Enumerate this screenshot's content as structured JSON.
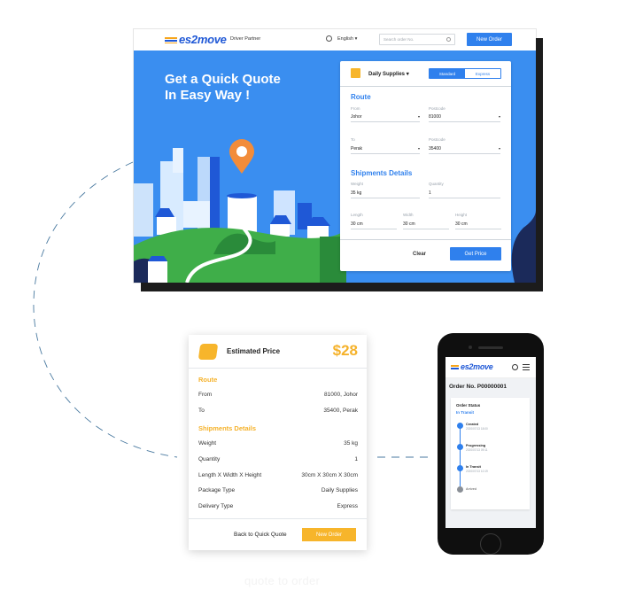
{
  "desktop": {
    "logo": {
      "prefix": "es",
      "two": "2",
      "suffix": "move"
    },
    "nav_driver": "Driver Partner",
    "language": "English",
    "search_placeholder": "Search order No.",
    "new_order": "New Order",
    "hero_title_1": "Get a Quick Quote",
    "hero_title_2": "In Easy Way !",
    "quote_card": {
      "package_type": "Daily Supplies",
      "delivery_options": [
        "Standard",
        "Express"
      ],
      "selected_delivery": "Standard",
      "route_title": "Route",
      "from_label": "From",
      "from_value": "Johor",
      "from_postcode_label": "Postcode",
      "from_postcode_value": "81000",
      "to_label": "To",
      "to_value": "Perak",
      "to_postcode_label": "Postcode",
      "to_postcode_value": "35400",
      "shipments_title": "Shipments Details",
      "weight_label": "Weight",
      "weight_value": "35 kg",
      "quantity_label": "Quantity",
      "quantity_value": "1",
      "length_label": "Length",
      "length_value": "30 cm",
      "width_label": "Width",
      "width_value": "30 cm",
      "height_label": "Height",
      "height_value": "30 cm",
      "clear": "Clear",
      "get_price": "Get Price"
    }
  },
  "price_card": {
    "title": "Estimated Price",
    "amount": "$28",
    "route_title": "Route",
    "from_label": "From",
    "from_value": "81000, Johor",
    "to_label": "To",
    "to_value": "35400, Perak",
    "shipments_title": "Shipments Details",
    "weight_label": "Weight",
    "weight_value": "35 kg",
    "quantity_label": "Quantity",
    "quantity_value": "1",
    "dims_label": "Length X Width X Height",
    "dims_value": "30cm X 30cm X 30cm",
    "package_label": "Package Type",
    "package_value": "Daily Supplies",
    "delivery_label": "Delivery Type",
    "delivery_value": "Express",
    "back": "Back to Quick Quote",
    "new_order": "New Order"
  },
  "phone": {
    "order_title": "Order No. P00000001",
    "status_title": "Order Status",
    "status_value": "In Transit",
    "steps": [
      {
        "label": "Created",
        "date": "2020/07/13 18:00",
        "done": true
      },
      {
        "label": "Progressing",
        "date": "2020/07/13 09:11",
        "done": true
      },
      {
        "label": "In Transit",
        "date": "2020/07/13 10:19",
        "done": true
      },
      {
        "label": "Arrived",
        "date": "",
        "done": false
      }
    ]
  },
  "caption": "quote to order",
  "colors": {
    "brand_blue": "#2f80ed",
    "hero_blue": "#3a8ef0",
    "accent_yellow": "#f7b52b",
    "pin_orange": "#f28c3a",
    "grass": "#3fae49"
  }
}
